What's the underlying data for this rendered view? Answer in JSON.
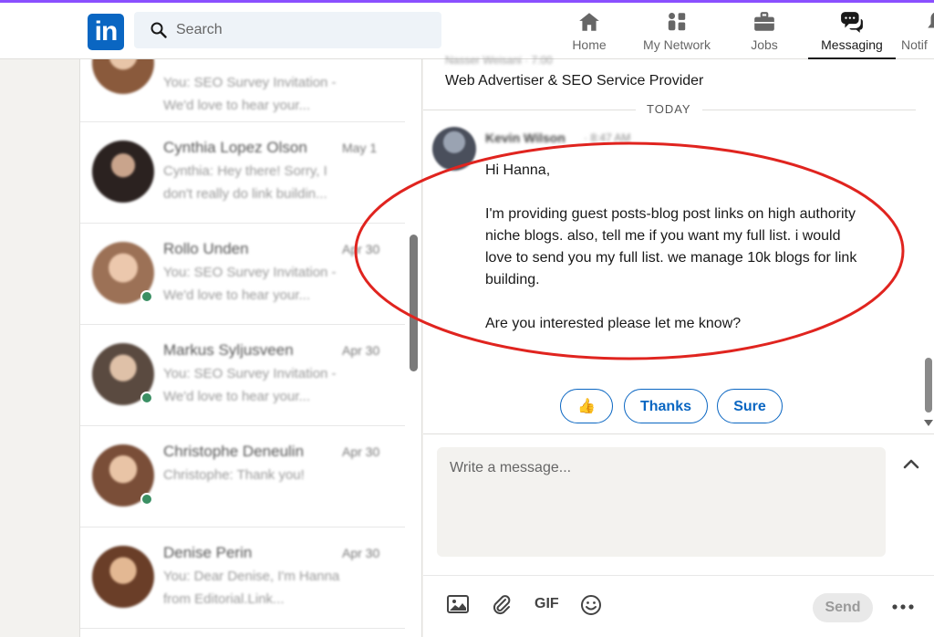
{
  "nav": {
    "search_placeholder": "Search",
    "items": [
      {
        "label": "Home",
        "icon": "home-icon"
      },
      {
        "label": "My Network",
        "icon": "network-icon"
      },
      {
        "label": "Jobs",
        "icon": "briefcase-icon"
      },
      {
        "label": "Messaging",
        "icon": "messaging-icon",
        "active": true
      },
      {
        "label": "Notif",
        "icon": "bell-icon"
      }
    ]
  },
  "logo": {
    "text": "in"
  },
  "conversations": [
    {
      "name": "",
      "date": "",
      "line1": "You: SEO Survey Invitation -",
      "line2": "We'd love to hear your..."
    },
    {
      "name": "Cynthia Lopez Olson",
      "date": "May 1",
      "line1": "Cynthia: Hey there! Sorry, I",
      "line2": "don't really do link buildin..."
    },
    {
      "name": "Rollo Unden",
      "date": "Apr 30",
      "line1": "You: SEO Survey Invitation -",
      "line2": "We'd love to hear your..."
    },
    {
      "name": "Markus Syljusveen",
      "date": "Apr 30",
      "line1": "You: SEO Survey Invitation -",
      "line2": "We'd love to hear your..."
    },
    {
      "name": "Christophe Deneulin",
      "date": "Apr 30",
      "line1": "Christophe: Thank you!",
      "line2": ""
    },
    {
      "name": "Denise Perin",
      "date": "Apr 30",
      "line1": "You: Dear Denise, I'm Hanna",
      "line2": "from Editorial.Link..."
    }
  ],
  "thread": {
    "previous_sender_line": "Nasser Weisani · 7:00",
    "previous_headline": "Web Advertiser & SEO Service Provider",
    "day_separator": "TODAY",
    "sender_name": "Kevin Wilson",
    "sender_time": "· 8:47 AM",
    "message": {
      "greeting": "Hi Hanna,",
      "paragraph": "I'm providing guest posts-blog post links on high authority niche blogs. also, tell me if you want my full list. i would love to send you my full list. we manage 10k blogs for link building.",
      "closing": "Are you interested please let me know?"
    },
    "quick_replies": [
      {
        "label": "👍",
        "kind": "emoji"
      },
      {
        "label": "Thanks",
        "kind": "text"
      },
      {
        "label": "Sure",
        "kind": "text"
      }
    ]
  },
  "composer": {
    "placeholder": "Write a message...",
    "gif_label": "GIF",
    "send_label": "Send"
  },
  "colors": {
    "brand": "#0a66c2",
    "annotation": "#e0241f",
    "online": "#3a8f63"
  }
}
